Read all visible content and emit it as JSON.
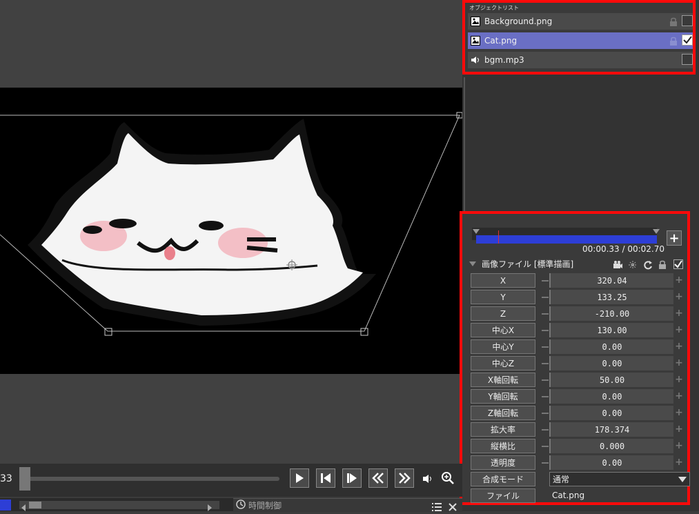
{
  "object_list": {
    "title": "オブジェクトリスト",
    "items": [
      {
        "label": "Background.png",
        "icon": "image-icon",
        "checked": false,
        "selected": false
      },
      {
        "label": "Cat.png",
        "icon": "image-icon",
        "checked": true,
        "selected": true
      },
      {
        "label": "bgm.mp3",
        "icon": "speaker-icon",
        "checked": false,
        "selected": false
      }
    ]
  },
  "timeline": {
    "time": "00:00.33 / 00:02.70",
    "add_label": "+"
  },
  "filter": {
    "title": "画像ファイル [標準描画]"
  },
  "properties": [
    {
      "label": "X",
      "value": "320.04"
    },
    {
      "label": "Y",
      "value": "133.25"
    },
    {
      "label": "Z",
      "value": "-210.00"
    },
    {
      "label": "中心X",
      "value": "130.00"
    },
    {
      "label": "中心Y",
      "value": "0.00"
    },
    {
      "label": "中心Z",
      "value": "0.00"
    },
    {
      "label": "X軸回転",
      "value": "50.00"
    },
    {
      "label": "Y軸回転",
      "value": "0.00"
    },
    {
      "label": "Z軸回転",
      "value": "0.00"
    },
    {
      "label": "拡大率",
      "value": "178.374"
    },
    {
      "label": "縦横比",
      "value": "0.000"
    },
    {
      "label": "透明度",
      "value": "0.00"
    }
  ],
  "blend": {
    "label": "合成モード",
    "value": "通常"
  },
  "file": {
    "label": "ファイル",
    "value": "Cat.png"
  },
  "transport": {
    "frame": "33"
  },
  "bottom": {
    "time_control": "時間制御"
  },
  "colors": {
    "highlight": "#ff0a0a",
    "selected_row": "#6a6fc4",
    "timeline_bar": "#2d3ed6"
  }
}
